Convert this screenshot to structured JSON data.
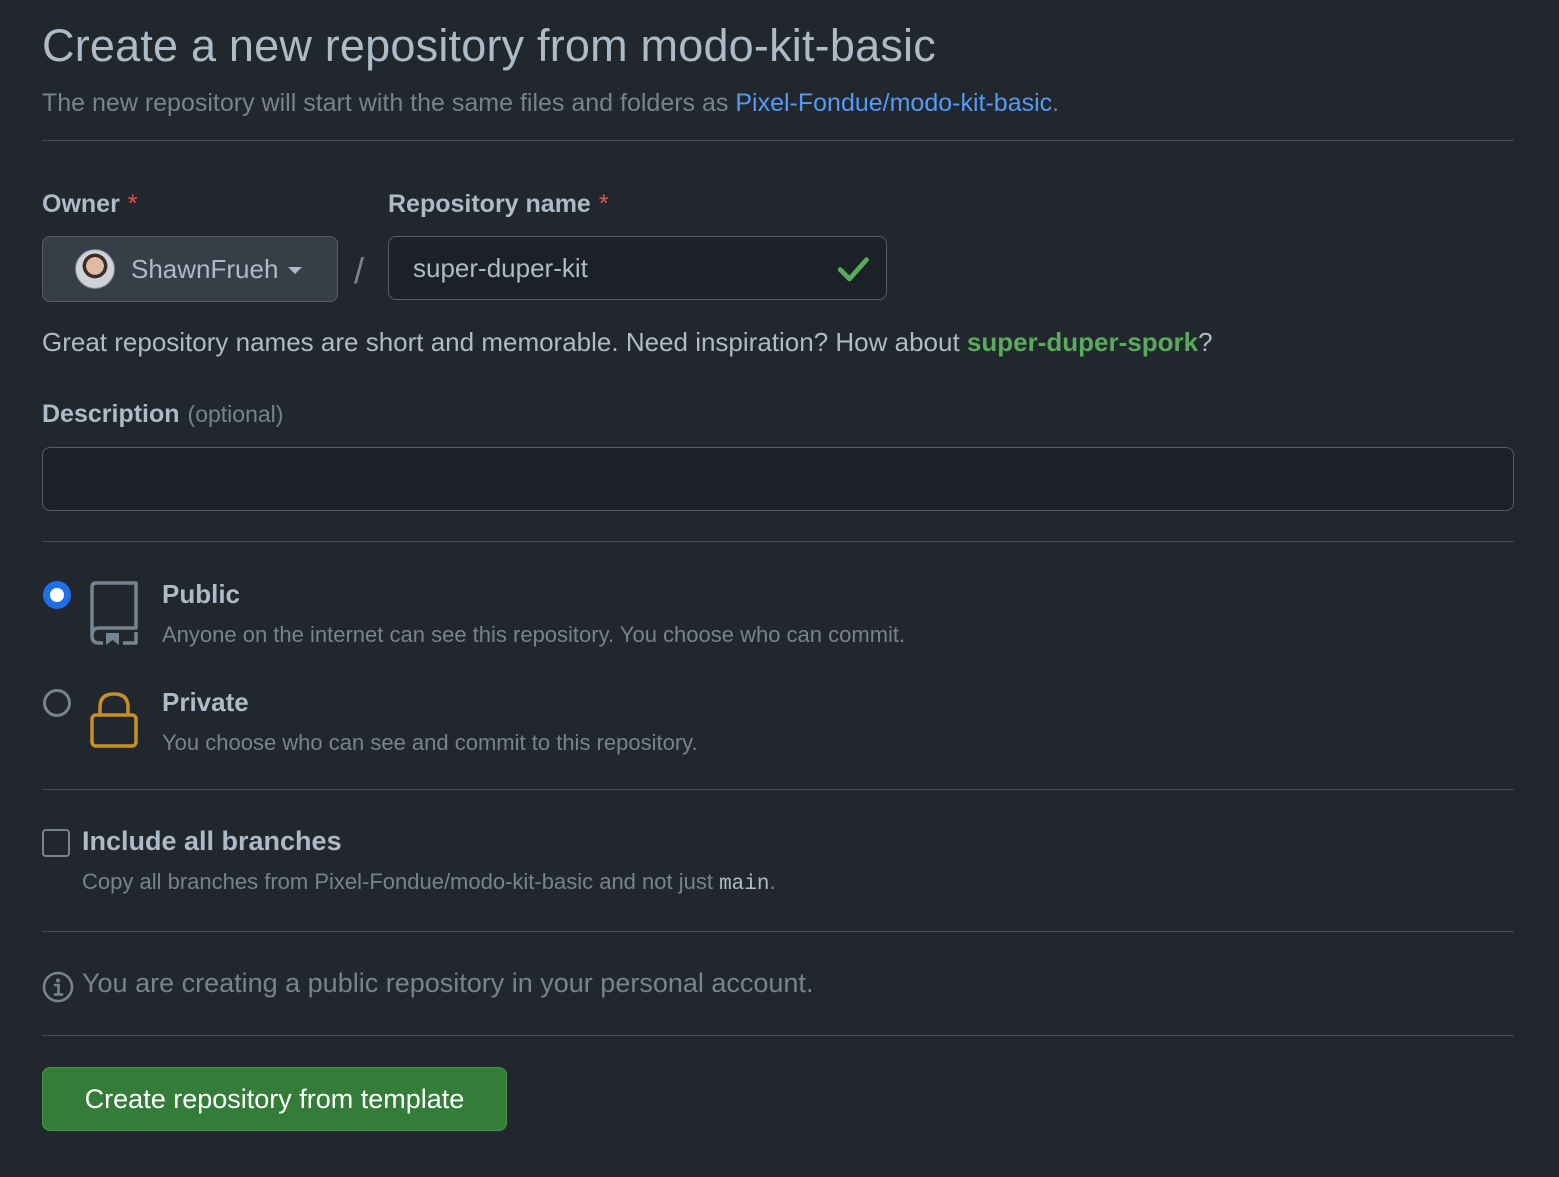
{
  "header": {
    "title": "Create a new repository from modo-kit-basic",
    "subtitle_prefix": "The new repository will start with the same files and folders as ",
    "template_link": "Pixel-Fondue/modo-kit-basic",
    "subtitle_suffix": "."
  },
  "owner": {
    "label": "Owner",
    "required_marker": "*",
    "selected": "ShawnFrueh"
  },
  "separator": "/",
  "repo_name": {
    "label": "Repository name",
    "required_marker": "*",
    "value": "super-duper-kit",
    "valid": true
  },
  "name_hint": {
    "prefix": "Great repository names are short and memorable. Need inspiration? How about ",
    "suggestion": "super-duper-spork",
    "suffix": "?"
  },
  "description": {
    "label": "Description",
    "optional_text": "(optional)",
    "value": ""
  },
  "visibility": {
    "selected": "public",
    "options": [
      {
        "id": "public",
        "title": "Public",
        "description": "Anyone on the internet can see this repository. You choose who can commit.",
        "icon": "repo-icon"
      },
      {
        "id": "private",
        "title": "Private",
        "description": "You choose who can see and commit to this repository.",
        "icon": "lock-icon"
      }
    ]
  },
  "branches": {
    "title": "Include all branches",
    "checked": false,
    "desc_prefix": "Copy all branches from Pixel-Fondue/modo-kit-basic and not just ",
    "branch_name": "main",
    "desc_suffix": "."
  },
  "info": {
    "icon": "info-icon",
    "text": "You are creating a public repository in your personal account."
  },
  "submit": {
    "label": "Create repository from template"
  },
  "colors": {
    "background": "#22272e",
    "link": "#539bf5",
    "success": "#57ab5a",
    "danger": "#e5534b",
    "primary_button": "#347d39",
    "radio_accent": "#1f6feb",
    "lock_icon": "#c69026"
  }
}
